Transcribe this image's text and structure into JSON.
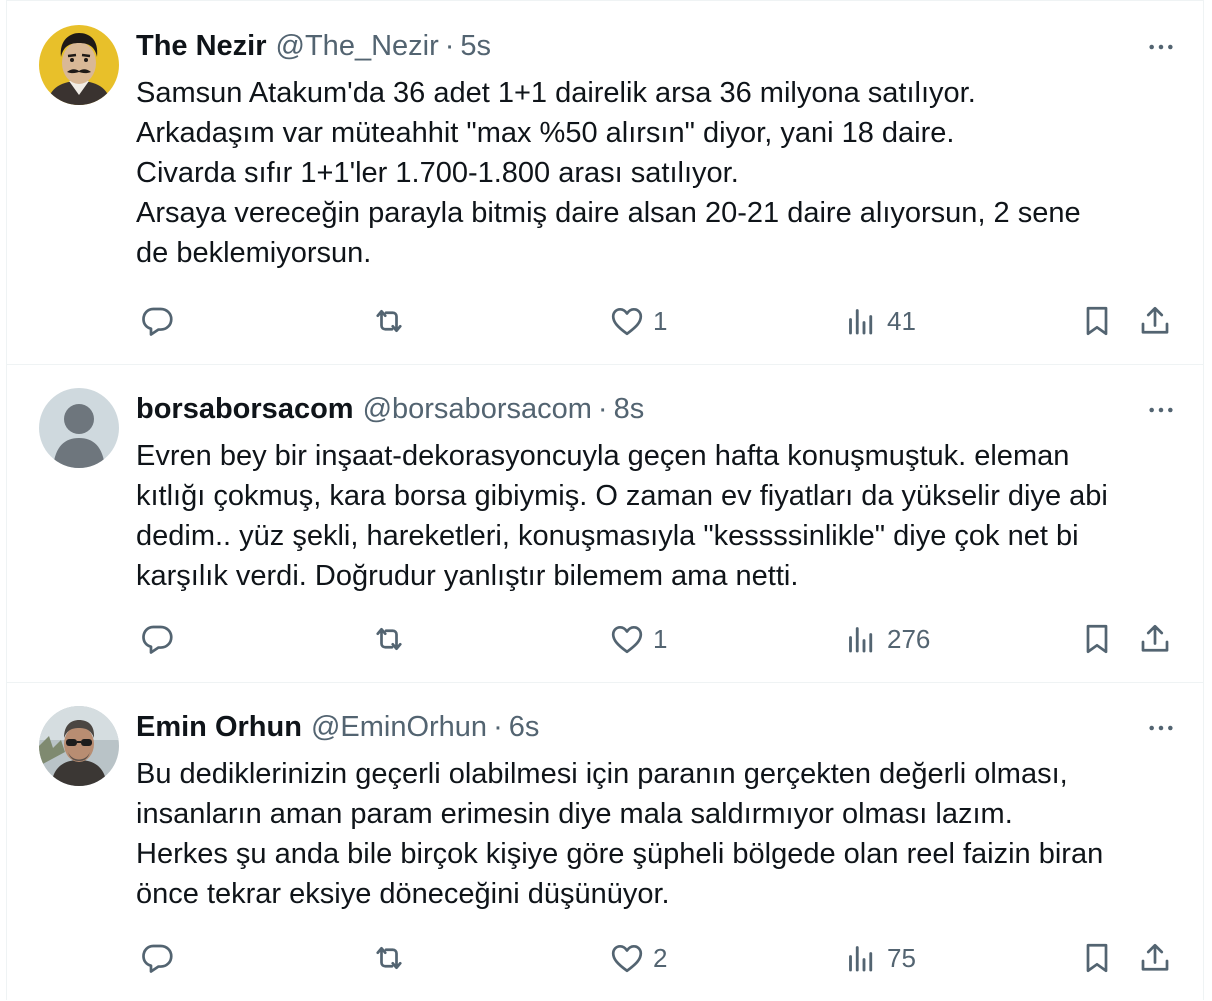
{
  "colors": {
    "text_primary": "#0f1419",
    "text_secondary": "#536471",
    "border": "#eff3f4",
    "icon": "#536471"
  },
  "icons": {
    "reply": "reply-icon",
    "retweet": "retweet-icon",
    "like": "heart-icon",
    "views": "views-chart-icon",
    "bookmark": "bookmark-icon",
    "share": "share-icon",
    "more": "more-options-icon"
  },
  "tweets": [
    {
      "name": "The Nezir",
      "handle": "@The_Nezir",
      "separator": "·",
      "time": "5s",
      "avatar": "illustrated-mustached-man-yellow-background",
      "text": "Samsun Atakum'da 36 adet 1+1 dairelik arsa 36 milyona satılıyor.\nArkadaşım var müteahhit \"max %50 alırsın\" diyor, yani 18 daire.\nCivarda sıfır 1+1'ler 1.700-1.800 arası satılıyor.\nArsaya vereceğin parayla bitmiş daire alsan 20-21 daire alıyorsun, 2 sene\nde beklemiyorsun.",
      "replies": "",
      "retweets": "",
      "likes": "1",
      "views": "41"
    },
    {
      "name": "borsaborsacom",
      "handle": "@borsaborsacom",
      "separator": "·",
      "time": "8s",
      "avatar": "default-profile-silhouette",
      "text": "Evren bey bir inşaat-dekorasyoncuyla geçen hafta konuşmuştuk. eleman\nkıtlığı çokmuş, kara borsa gibiymiş. O zaman ev fiyatları da yükselir diye abi\ndedim.. yüz şekli, hareketleri, konuşmasıyla \"kessssinlikle\" diye çok net bi\nkarşılık verdi. Doğrudur yanlıştır bilemem ama netti.",
      "replies": "",
      "retweets": "",
      "likes": "1",
      "views": "276"
    },
    {
      "name": "Emin Orhun",
      "handle": "@EminOrhun",
      "separator": "·",
      "time": "6s",
      "avatar": "man-with-sunglasses-photo",
      "text": "Bu dediklerinizin geçerli olabilmesi için paranın gerçekten değerli olması,\ninsanların aman param erimesin diye mala saldırmıyor olması lazım.\nHerkes şu anda bile birçok kişiye göre şüpheli bölgede olan reel faizin biran\nönce tekrar eksiye döneceğini düşünüyor.",
      "replies": "",
      "retweets": "",
      "likes": "2",
      "views": "75"
    }
  ]
}
